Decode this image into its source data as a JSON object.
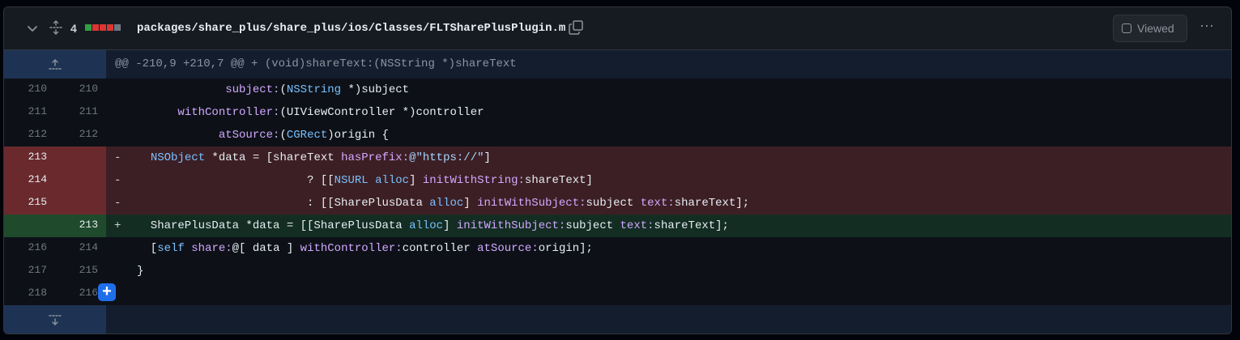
{
  "file": {
    "changes_count": "4",
    "path": "packages/share_plus/share_plus/ios/Classes/FLTSharePlusPlugin.m",
    "viewed_label": "Viewed",
    "stat_colors": [
      "#2ea043",
      "#da3633",
      "#da3633",
      "#da3633",
      "#6e7681"
    ]
  },
  "hunk_header": "@@ -210,9 +210,7 @@ + (void)shareText:(NSString *)shareText",
  "lines": [
    {
      "type": "ctx",
      "old": "210",
      "new": "210",
      "marker": "",
      "segments": [
        {
          "t": "             "
        },
        {
          "t": "subject:",
          "c": "f"
        },
        {
          "t": "(",
          "c": ""
        },
        {
          "t": "NSString",
          "c": "t"
        },
        {
          "t": " *)subject"
        }
      ]
    },
    {
      "type": "ctx",
      "old": "211",
      "new": "211",
      "marker": "",
      "segments": [
        {
          "t": "      "
        },
        {
          "t": "withController:",
          "c": "f"
        },
        {
          "t": "(UIViewController *)controller"
        }
      ]
    },
    {
      "type": "ctx",
      "old": "212",
      "new": "212",
      "marker": "",
      "segments": [
        {
          "t": "            "
        },
        {
          "t": "atSource:",
          "c": "f"
        },
        {
          "t": "("
        },
        {
          "t": "CGRect",
          "c": "t"
        },
        {
          "t": ")origin {"
        }
      ]
    },
    {
      "type": "del",
      "old": "213",
      "new": "",
      "marker": "-",
      "segments": [
        {
          "t": "  "
        },
        {
          "t": "NSObject",
          "c": "t"
        },
        {
          "t": " *data = [shareText "
        },
        {
          "t": "hasPrefix:",
          "c": "f"
        },
        {
          "t": "@\"https://\"",
          "c": "s"
        },
        {
          "t": "]"
        }
      ]
    },
    {
      "type": "del",
      "old": "214",
      "new": "",
      "marker": "-",
      "segments": [
        {
          "t": "                         ? [["
        },
        {
          "t": "NSURL",
          "c": "t"
        },
        {
          "t": " "
        },
        {
          "t": "alloc",
          "c": "t"
        },
        {
          "t": "] "
        },
        {
          "t": "initWithString:",
          "c": "f"
        },
        {
          "t": "shareText]"
        }
      ]
    },
    {
      "type": "del",
      "old": "215",
      "new": "",
      "marker": "-",
      "segments": [
        {
          "t": "                         : [[SharePlusData "
        },
        {
          "t": "alloc",
          "c": "t"
        },
        {
          "t": "] "
        },
        {
          "t": "initWithSubject:",
          "c": "f"
        },
        {
          "t": "subject "
        },
        {
          "t": "text:",
          "c": "f"
        },
        {
          "t": "shareText];"
        }
      ]
    },
    {
      "type": "add",
      "old": "",
      "new": "213",
      "marker": "+",
      "segments": [
        {
          "t": "  SharePlusData *data = [[SharePlusData "
        },
        {
          "t": "alloc",
          "c": "t"
        },
        {
          "t": "] "
        },
        {
          "t": "initWithSubject:",
          "c": "f"
        },
        {
          "t": "subject "
        },
        {
          "t": "text:",
          "c": "f"
        },
        {
          "t": "shareText];"
        }
      ]
    },
    {
      "type": "ctx",
      "old": "216",
      "new": "214",
      "marker": "",
      "segments": [
        {
          "t": "  ["
        },
        {
          "t": "self",
          "c": "t"
        },
        {
          "t": " "
        },
        {
          "t": "share:",
          "c": "f"
        },
        {
          "t": "@[ data ] "
        },
        {
          "t": "withController:",
          "c": "f"
        },
        {
          "t": "controller "
        },
        {
          "t": "atSource:",
          "c": "f"
        },
        {
          "t": "origin];"
        }
      ]
    },
    {
      "type": "ctx",
      "old": "217",
      "new": "215",
      "marker": "",
      "segments": [
        {
          "t": "}"
        }
      ]
    },
    {
      "type": "ctx",
      "old": "218",
      "new": "216",
      "marker": "",
      "segments": [
        {
          "t": ""
        }
      ]
    }
  ]
}
